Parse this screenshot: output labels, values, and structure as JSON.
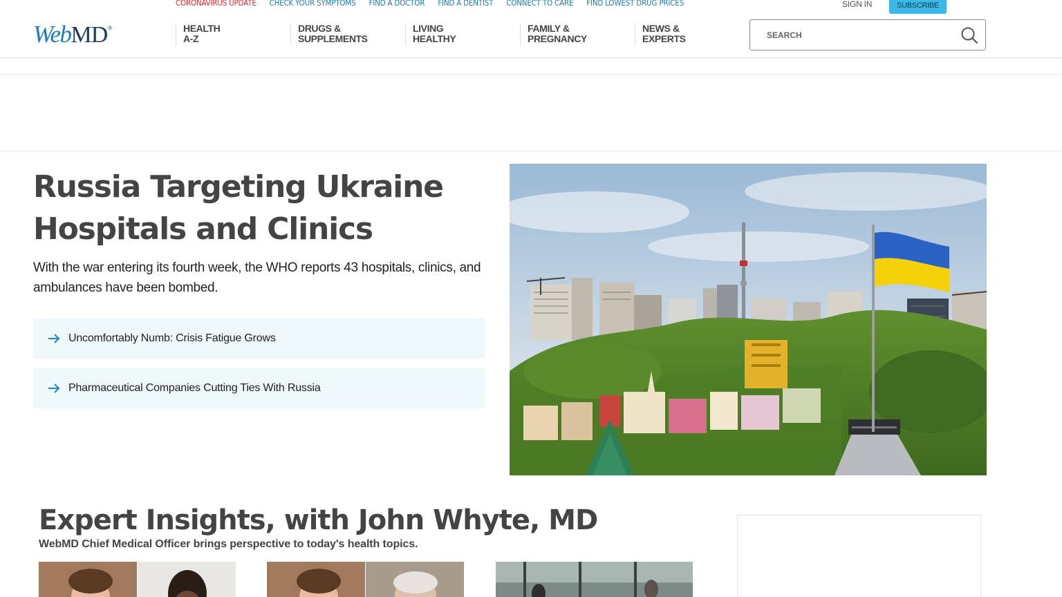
{
  "top_links": [
    {
      "label": "CORONAVIRUS UPDATE",
      "alert": true
    },
    {
      "label": "CHECK YOUR SYMPTOMS"
    },
    {
      "label": "FIND A DOCTOR"
    },
    {
      "label": "FIND A DENTIST"
    },
    {
      "label": "CONNECT TO CARE"
    },
    {
      "label": "FIND LOWEST DRUG PRICES"
    }
  ],
  "account": {
    "sign_in": "SIGN IN",
    "subscribe": "SUBSCRIBE"
  },
  "logo": {
    "web": "Web",
    "md": "MD",
    "mark": "®"
  },
  "main_nav": [
    {
      "label": "HEALTH\nA-Z"
    },
    {
      "label": "DRUGS &\nSUPPLEMENTS"
    },
    {
      "label": "LIVING\nHEALTHY"
    },
    {
      "label": "FAMILY &\nPREGNANCY"
    },
    {
      "label": "NEWS &\nEXPERTS"
    }
  ],
  "search": {
    "placeholder": "SEARCH",
    "icon": "magnifier-icon"
  },
  "hero": {
    "title": "Russia Targeting Ukraine Hospitals and Clinics",
    "description": "With the war entering its fourth week, the WHO reports 43 hospitals, clinics, and ambulances have been bombed.",
    "related": [
      {
        "label": "Uncomfortably Numb: Crisis Fatigue Grows"
      },
      {
        "label": "Pharmaceutical Companies Cutting Ties With Russia"
      }
    ]
  },
  "expert": {
    "title": "Expert Insights, with John Whyte, MD",
    "subtitle": "WebMD Chief Medical Officer brings perspective to today's health topics."
  },
  "colors": {
    "link": "#1e7eb4",
    "alert": "#e8262c",
    "subscribe": "#3bb8e6",
    "flag_blue": "#2a63c4",
    "flag_yellow": "#f5d10a"
  }
}
